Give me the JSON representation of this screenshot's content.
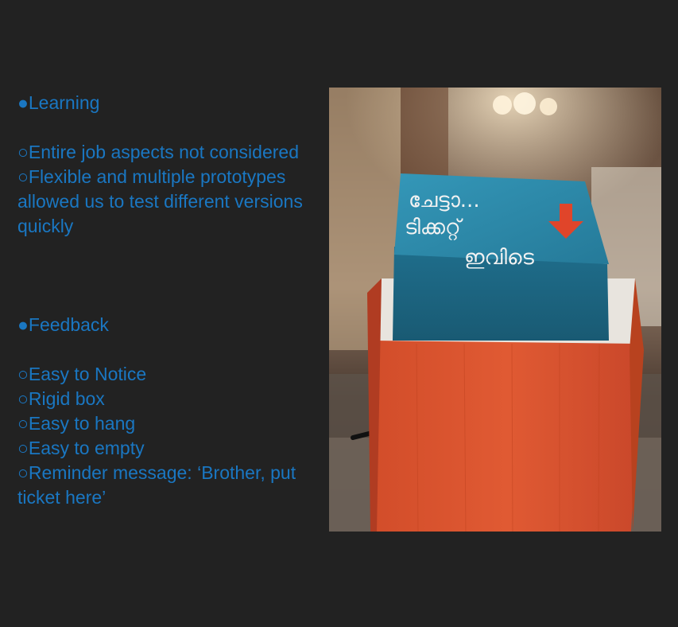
{
  "slide": {
    "learning": {
      "heading": "●Learning",
      "points": [
        "○Entire job aspects not considered",
        "○Flexible and multiple prototypes allowed us to test different versions quickly"
      ]
    },
    "feedback": {
      "heading": "●Feedback",
      "points": [
        "○Easy to Notice",
        "○Rigid box",
        "○Easy to hang",
        "○Easy to empty",
        "○Reminder message: ‘Brother, put ticket here’"
      ]
    }
  },
  "photo": {
    "sign_line_1": "ചേട്ടാ...",
    "sign_line_2": "ടിക്കറ്റ്",
    "sign_line_3": "ഇവിടെ"
  },
  "colors": {
    "background": "#222222",
    "text": "#1a77c2",
    "box_top": "#2f8fae",
    "box_front": "#d9532e"
  }
}
